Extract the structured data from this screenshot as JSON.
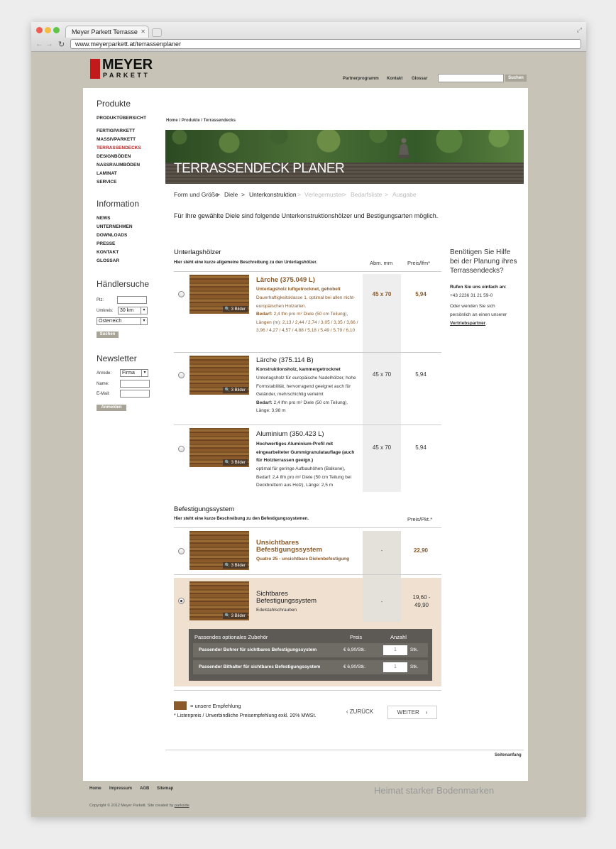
{
  "browser": {
    "tab_title": "Meyer Parkett Terrasse",
    "url": "www.meyerparkett.at/terrassenplaner"
  },
  "logo": {
    "name": "MEYER",
    "sub": "PARKETT"
  },
  "topnav": [
    "Partnerprogramm",
    "Kontakt",
    "Glossar"
  ],
  "top_search": {
    "button": "Suchen"
  },
  "sidebar": {
    "produkte_title": "Produkte",
    "produkte_overview": "PRODUKTÜBERSICHT",
    "produkte_items": [
      "FERTIGPARKETT",
      "MASSIVPARKETT",
      "TERRASSENDECKS",
      "DESIGNBÖDEN",
      "NASSRAUMBÖDEN",
      "LAMINAT",
      "SERVICE"
    ],
    "info_title": "Information",
    "info_items": [
      "NEWS",
      "UNTERNEHMEN",
      "DOWNLOADS",
      "PRESSE",
      "KONTAKT",
      "GLOSSAR"
    ],
    "dealer_title": "Händlersuche",
    "plz_label": "Plz:",
    "umkreis_label": "Umkreis:",
    "umkreis_value": "30 km",
    "country_value": "Österreich",
    "dealer_button": "Suchen",
    "newsletter_title": "Newsletter",
    "anrede_label": "Anrede:",
    "anrede_value": "Firma",
    "name_label": "Name:",
    "email_label": "E-Mail:",
    "newsletter_button": "Anmelden"
  },
  "breadcrumb": {
    "home": "Home",
    "sep": "/",
    "produkte": "Produkte",
    "current": "Terrassendecks"
  },
  "hero_title": "TERRASSENDECK PLANER",
  "steps": [
    "Form und Größe",
    "Diele",
    "Unterkonstruktion",
    "Verlegemuster",
    "Bedarfsliste",
    "Ausgabe"
  ],
  "step_sep": ">",
  "intro": "Für Ihre gewählte Diele sind folgende Unterkonstruktionshölzer und Bestigungsarten möglich.",
  "unterlag": {
    "title": "Unterlagshölzer",
    "desc": "Hier steht eine kurze allgemeine Beschreibung zu den Unterlagshölzer.",
    "col_abm": "Abm. mm",
    "col_price": "Preis/lfm*",
    "items": [
      {
        "title": "Lärche (375.049 L)",
        "subtitle": "Unterlagsholz luftgetrocknet, gehobelt",
        "desc": "Dauerhaftigkeitsklasse 1, optimal bei allen nicht-europäischen Holzarten.",
        "bedarf_label": "Bedarf:",
        "bedarf": "2,4 lfm pro m² Diele (50 cm Teilung), Längen (m): 2,13 / 2,44 / 2,74 / 3,05 / 3,35 / 3,66 / 3,96 / 4,27 / 4,57 / 4,88 / 5,18 / 5,49 / 5,79 / 6,10",
        "abm": "45 x 70",
        "price": "5,94",
        "images": "3 Bilder"
      },
      {
        "title": "Lärche (375.114 B)",
        "subtitle": "Konstruktionsholz, kammergetrocknet",
        "desc": "Unterlagsholz für europäische Nadelhölzer, hohe Formstabilität, hervorragend geeignet auch für Geländer, mehrschichtig verleimt",
        "bedarf_label": "Bedarf:",
        "bedarf": "2,4 lfm pro m² Diele (50 cm Teilung). Länge: 3,98 m",
        "abm": "45 x 70",
        "price": "5,94",
        "images": "3 Bilder"
      },
      {
        "title": "Aluminium (350.423 L)",
        "subtitle": "Hochwertiges Aluminium-Profil mit eingearbeiteter Gummigranulatauflage (auch für Holzterrassen geeign.)",
        "desc": "optimal für geringe Aufbauhöhen (Balkone), Bedarf: 2,4 lfm pro m² Diele (50 cm Teilung bei Deckbrettern aus Holz), Länge: 2,5 m",
        "abm": "45 x 70",
        "price": "5,94",
        "images": "3 Bilder"
      }
    ]
  },
  "befestigung": {
    "title": "Befestigungssystem",
    "desc": "Hier steht eine kurze Beschreibung zu den Befestigungssystemen.",
    "col_price": "Preis/Pkt.*",
    "items": [
      {
        "title": "Unsichtbares Befestigungssystem",
        "subtitle": "Quatro 25 - unsichtbare Dielenbefestigung",
        "abm": "-",
        "price": "22,90",
        "images": "3 Bilder"
      },
      {
        "title": "Sichtbares Befestigungssystem",
        "subtitle": "Edelstahlschrauben",
        "abm": "-",
        "price": "19,60 - 49,90",
        "images": "3 Bilder"
      }
    ]
  },
  "accessories": {
    "title": "Passendes optionales Zubehör",
    "col_price": "Preis",
    "col_qty": "Anzahl",
    "rows": [
      {
        "name": "Passender Bohrer für sichtbares Befestigungssystem",
        "price": "€ 6,90/Stk.",
        "qty": "1",
        "unit": "Stk."
      },
      {
        "name": "Passender Bithalter für sichtbares Befestigungssystem",
        "price": "€ 6,90/Stk.",
        "qty": "1",
        "unit": "Stk."
      }
    ]
  },
  "legend": "= unsere Empfehlung",
  "footnote": "* Listenpreis / Unverbindliche Preisempfehlung exkl. 20% MWSt.",
  "nav": {
    "back": "ZURÜCK",
    "next": "WEITER"
  },
  "seitenanfang": "Seitenanfang",
  "help": {
    "title": "Benötigen Sie Hilfe bei der Planung ihres Terrassendecks?",
    "call_label": "Rufen Sie uns einfach an:",
    "phone": "+43 2236 31 21 59-0",
    "text": "Oder wenden Sie sich persönlich an einen unserer",
    "link": "Vertriebspartner",
    "end": "."
  },
  "slogan": "Heimat starker Bodenmarken",
  "footer": [
    "Home",
    "Impressum",
    "AGB",
    "Sitemap"
  ],
  "copyright": "Copyright © 2012 Meyer Parkett. Site created by",
  "copyright_link": "parkside",
  "colors": {
    "brand_red": "#c21a1a",
    "brown": "#8b5a2a",
    "selected_bg": "#f0e0d0"
  }
}
